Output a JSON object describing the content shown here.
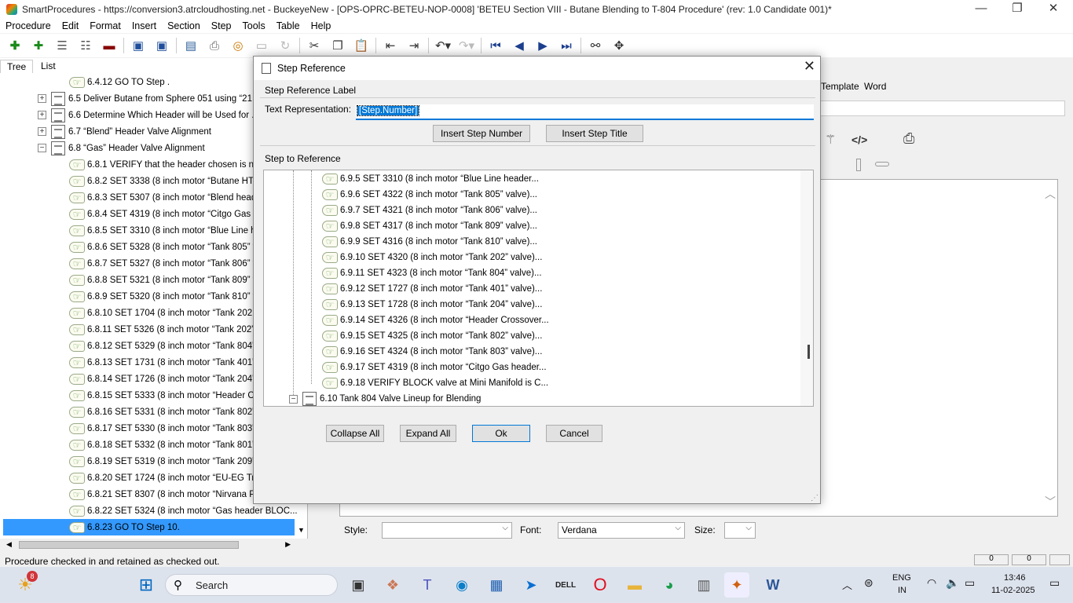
{
  "window": {
    "title": "SmartProcedures - https://conversion3.atrcloudhosting.net - BuckeyeNew - [OPS-OPRC-BETEU-NOP-0008] 'BETEU Section VIII - Butane Blending to T-804 Procedure' (rev: 1.0 Candidate 001)*",
    "minimize": "—",
    "restore": "❐",
    "close": "✕"
  },
  "menu": [
    "Procedure",
    "Edit",
    "Format",
    "Insert",
    "Section",
    "Step",
    "Tools",
    "Table",
    "Help"
  ],
  "toolbar_icons": [
    "add-icon",
    "add-child-icon",
    "list-icon",
    "list-alt-icon",
    "remove-icon",
    "save-icon",
    "save-all-icon",
    "publish-icon",
    "print-icon",
    "ring-icon",
    "blank-icon",
    "redo-disabled-icon",
    "cut-icon",
    "copy-icon",
    "paste-icon",
    "outdent-icon",
    "indent-icon",
    "undo-icon",
    "redo-icon",
    "first-icon",
    "prev-icon",
    "next-icon",
    "last-icon",
    "binoculars-icon",
    "move-icon"
  ],
  "left_tabs": [
    "Tree",
    "List"
  ],
  "tree": [
    {
      "label": "6.4.12 GO TO Step .",
      "type": "step"
    },
    {
      "label": "6.5 Deliver Butane from Sphere 051 using “21...",
      "type": "section",
      "expander": "+"
    },
    {
      "label": "6.6 Determine Which Header will be Used for ...",
      "type": "section",
      "expander": "+"
    },
    {
      "label": "6.7 “Blend” Header Valve Alignment",
      "type": "section",
      "expander": "+"
    },
    {
      "label": "6.8 “Gas” Header Valve Alignment",
      "type": "section",
      "expander": "−"
    },
    {
      "label": "6.8.1 VERIFY that the header chosen is not",
      "type": "step"
    },
    {
      "label": "6.8.2 SET 3338 (8 inch motor “Butane HTI he",
      "type": "step"
    },
    {
      "label": "6.8.3 SET 5307 (8 inch motor “Blend header",
      "type": "step"
    },
    {
      "label": "6.8.4 SET 4319 (8 inch motor “Citgo Gas hea",
      "type": "step"
    },
    {
      "label": "6.8.5 SET 3310 (8 inch motor “Blue Line hea",
      "type": "step"
    },
    {
      "label": "6.8.6 SET 5328 (8 inch motor “Tank 805” val",
      "type": "step"
    },
    {
      "label": "6.8.7 SET 5327 (8 inch motor “Tank 806” val",
      "type": "step"
    },
    {
      "label": "6.8.8 SET 5321 (8 inch motor “Tank 809” val",
      "type": "step"
    },
    {
      "label": "6.8.9 SET 5320 (8 inch motor “Tank 810” val",
      "type": "step"
    },
    {
      "label": "6.8.10 SET 1704 (8 inch motor “Tank 202 Re",
      "type": "step"
    },
    {
      "label": "6.8.11 SET 5326 (8 inch motor “Tank 202” va",
      "type": "step"
    },
    {
      "label": "6.8.12 SET 5329 (8 inch motor “Tank 804” va",
      "type": "step"
    },
    {
      "label": "6.8.13 SET 1731 (8 inch motor “Tank 401” va",
      "type": "step"
    },
    {
      "label": "6.8.14 SET 1726 (8 inch motor “Tank 204” va",
      "type": "step"
    },
    {
      "label": "6.8.15 SET 5333 (8 inch motor “Header Cros",
      "type": "step"
    },
    {
      "label": "6.8.16 SET 5331 (8 inch motor “Tank 802” va",
      "type": "step"
    },
    {
      "label": "6.8.17 SET 5330 (8 inch motor “Tank 803” va",
      "type": "step"
    },
    {
      "label": "6.8.18 SET 5332 (8 inch motor “Tank 801” va",
      "type": "step"
    },
    {
      "label": "6.8.19 SET 5319 (8 inch motor “Tank 209” va",
      "type": "step"
    },
    {
      "label": "6.8.20 SET 1724 (8 inch motor “EU-EG Trans",
      "type": "step"
    },
    {
      "label": "6.8.21 SET 8307 (8 inch motor “Nirvana Proc",
      "type": "step"
    },
    {
      "label": "6.8.22 SET 5324 (8 inch motor “Gas header BLOC...",
      "type": "step"
    },
    {
      "label": "6.8.23 GO TO Step 10.",
      "type": "step",
      "selected": true
    }
  ],
  "right_tabs": [
    "Template",
    "Word"
  ],
  "bottom": {
    "style_label": "Style:",
    "style_value": "",
    "font_label": "Font:",
    "font_value": "Verdana",
    "size_label": "Size:",
    "size_value": ""
  },
  "status": "Procedure checked in and retained as checked out.",
  "status_right": [
    "0",
    "0"
  ],
  "dialog": {
    "title": "Step Reference",
    "close": "✕",
    "label_group": "Step Reference Label",
    "text_rep_label": "Text Representation:",
    "text_rep_value": "[Step.Number]",
    "insert_number": "Insert Step Number",
    "insert_title": "Insert Step Title",
    "ref_group": "Step to Reference",
    "steps": [
      "6.9.5 SET 3310 (8 inch motor “Blue Line header...",
      "6.9.6 SET 4322 (8 inch motor “Tank 805” valve)...",
      "6.9.7 SET 4321 (8 inch motor “Tank 806” valve)...",
      "6.9.8 SET 4317 (8 inch motor “Tank 809” valve)...",
      "6.9.9 SET 4316 (8 inch motor “Tank 810” valve)...",
      "6.9.10 SET 4320 (8 inch motor “Tank 202” valve)...",
      "6.9.11 SET 4323 (8 inch motor “Tank 804” valve)...",
      "6.9.12 SET 1727 (8 inch motor “Tank 401” valve)...",
      "6.9.13 SET 1728 (8 inch motor “Tank 204” valve)...",
      "6.9.14 SET 4326 (8 inch motor “Header Crossover...",
      "6.9.15 SET 4325 (8 inch motor “Tank 802” valve)...",
      "6.9.16 SET 4324 (8 inch motor “Tank 803” valve)...",
      "6.9.17 SET 4319 (8 inch motor “Citgo Gas header...",
      "6.9.18 VERIFY BLOCK valve at Mini Manifold is C..."
    ],
    "section_row": "6.10 Tank 804 Valve Lineup for Blending",
    "collapse_all": "Collapse All",
    "expand_all": "Expand All",
    "ok": "Ok",
    "cancel": "Cancel"
  },
  "taskbar": {
    "weather_badge": "8",
    "search": "Search",
    "lang_top": "ENG",
    "lang_bottom": "IN",
    "time": "13:46",
    "date": "11-02-2025"
  }
}
